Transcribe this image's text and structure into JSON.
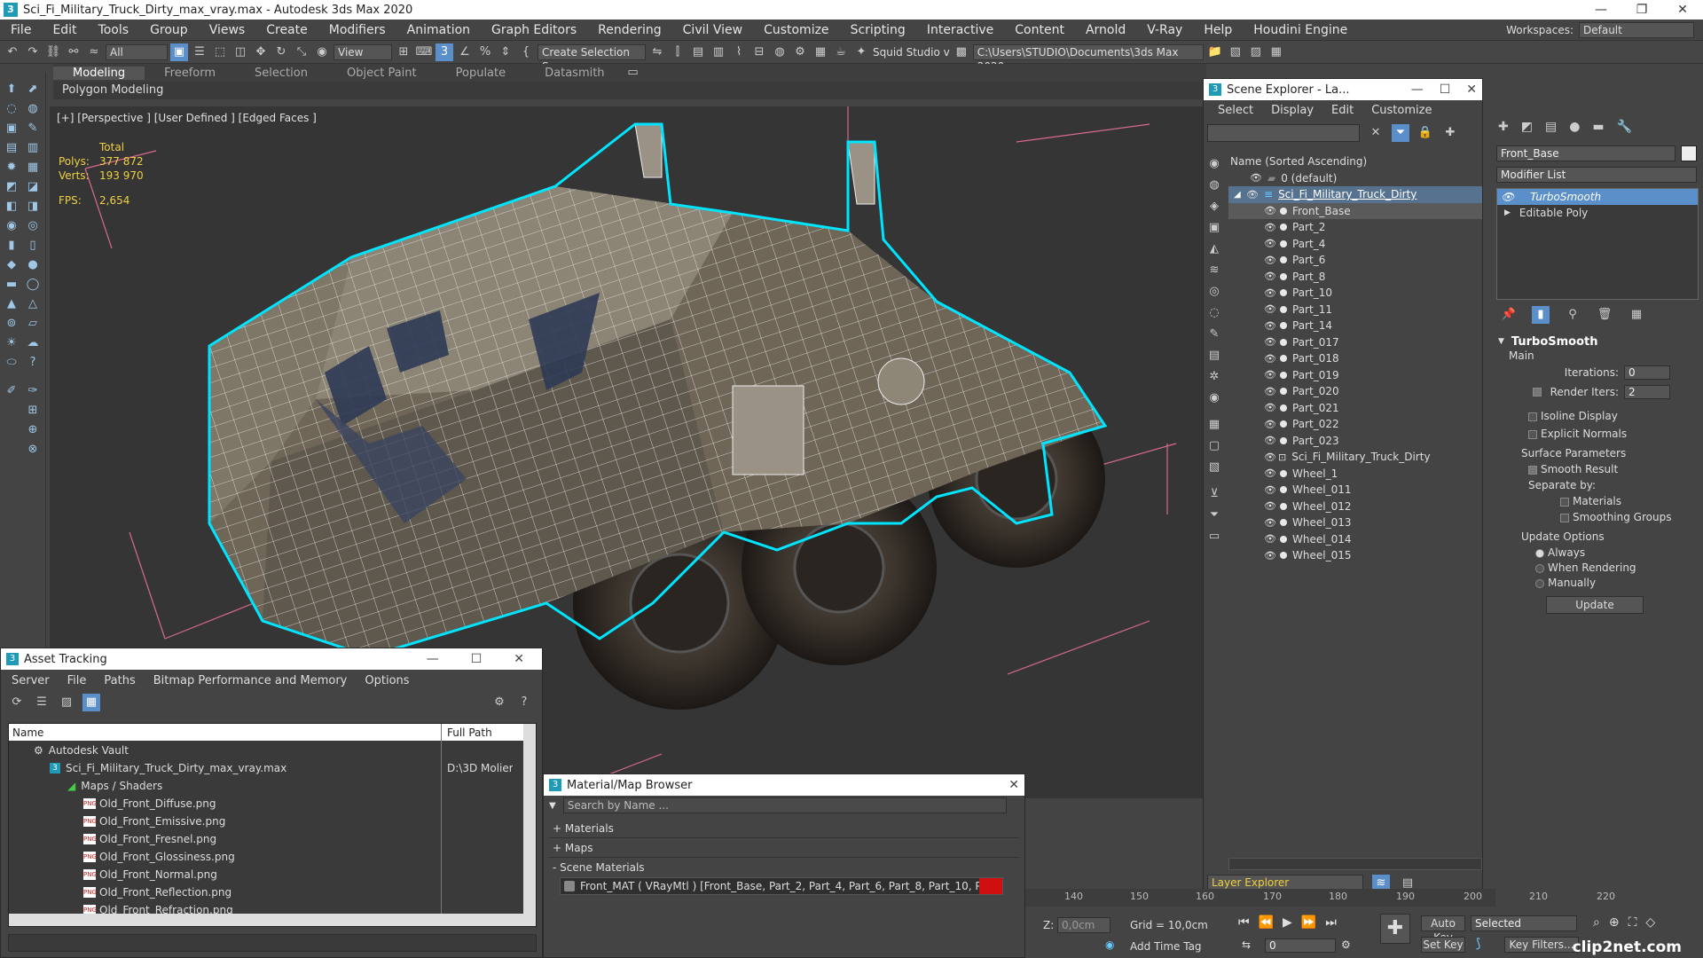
{
  "window": {
    "title": "Sci_Fi_Military_Truck_Dirty_max_vray.max - Autodesk 3ds Max 2020",
    "app_icon": "3"
  },
  "menu": {
    "items": [
      "File",
      "Edit",
      "Tools",
      "Group",
      "Views",
      "Create",
      "Modifiers",
      "Animation",
      "Graph Editors",
      "Rendering",
      "Civil View",
      "Customize",
      "Scripting",
      "Interactive",
      "Content",
      "Arnold",
      "V-Ray",
      "Help",
      "Houdini Engine"
    ],
    "workspaces_label": "Workspaces:",
    "workspace_value": "Default"
  },
  "toolbar": {
    "filter_value": "All",
    "view_value": "View",
    "selection_set_placeholder": "Create Selection Se",
    "user_label": "Squid Studio v",
    "project_path": "C:\\Users\\STUDIO\\Documents\\3ds Max 2020"
  },
  "ribbon": {
    "tabs": [
      "Modeling",
      "Freeform",
      "Selection",
      "Object Paint",
      "Populate",
      "Datasmith"
    ],
    "active": "Modeling",
    "subpanel": "Polygon Modeling"
  },
  "viewport": {
    "label": "[+] [Perspective ] [User Defined ] [Edged Faces ]",
    "stats": {
      "total_label": "Total",
      "polys_label": "Polys:",
      "polys_value": "377 872",
      "verts_label": "Verts:",
      "verts_value": "193 970",
      "fps_label": "FPS:",
      "fps_value": "2,654"
    }
  },
  "scene_explorer": {
    "title": "Scene Explorer - La...",
    "menu": [
      "Select",
      "Display",
      "Edit",
      "Customize"
    ],
    "column_header": "Name (Sorted Ascending)",
    "default_layer": "0 (default)",
    "root": "Sci_Fi_Military_Truck_Dirty",
    "children": [
      "Front_Base",
      "Part_2",
      "Part_4",
      "Part_6",
      "Part_8",
      "Part_10",
      "Part_11",
      "Part_14",
      "Part_017",
      "Part_018",
      "Part_019",
      "Part_020",
      "Part_021",
      "Part_022",
      "Part_023",
      "Sci_Fi_Military_Truck_Dirty",
      "Wheel_1",
      "Wheel_011",
      "Wheel_012",
      "Wheel_013",
      "Wheel_014",
      "Wheel_015"
    ],
    "footer": "Layer Explorer"
  },
  "command_panel": {
    "object_name": "Front_Base",
    "modifier_list_label": "Modifier List",
    "stack": [
      "TurboSmooth",
      "Editable Poly"
    ],
    "turbosmooth": {
      "title": "TurboSmooth",
      "main_label": "Main",
      "iterations_label": "Iterations:",
      "iterations_value": "0",
      "render_iters_label": "Render Iters:",
      "render_iters_value": "2",
      "isoline_label": "Isoline Display",
      "explicit_normals_label": "Explicit Normals",
      "surface_params_label": "Surface Parameters",
      "smooth_result_label": "Smooth Result",
      "separate_by_label": "Separate by:",
      "materials_label": "Materials",
      "smoothing_groups_label": "Smoothing Groups",
      "update_options_label": "Update Options",
      "always_label": "Always",
      "when_rendering_label": "When Rendering",
      "manually_label": "Manually",
      "update_button": "Update"
    }
  },
  "asset_tracking": {
    "title": "Asset Tracking",
    "menu": [
      "Server",
      "File",
      "Paths",
      "Bitmap Performance and Memory",
      "Options"
    ],
    "col_name": "Name",
    "col_path": "Full Path",
    "rows": [
      {
        "name": "Autodesk Vault",
        "path": "",
        "level": 1,
        "icon": "vault"
      },
      {
        "name": "Sci_Fi_Military_Truck_Dirty_max_vray.max",
        "path": "D:\\3D Molier",
        "level": 2,
        "icon": "max"
      },
      {
        "name": "Maps / Shaders",
        "path": "",
        "level": 3,
        "icon": "maps"
      },
      {
        "name": "Old_Front_Diffuse.png",
        "path": "",
        "level": 4,
        "icon": "png"
      },
      {
        "name": "Old_Front_Emissive.png",
        "path": "",
        "level": 4,
        "icon": "png"
      },
      {
        "name": "Old_Front_Fresnel.png",
        "path": "",
        "level": 4,
        "icon": "png"
      },
      {
        "name": "Old_Front_Glossiness.png",
        "path": "",
        "level": 4,
        "icon": "png"
      },
      {
        "name": "Old_Front_Normal.png",
        "path": "",
        "level": 4,
        "icon": "png"
      },
      {
        "name": "Old_Front_Reflection.png",
        "path": "",
        "level": 4,
        "icon": "png"
      },
      {
        "name": "Old_Front_Refraction.png",
        "path": "",
        "level": 4,
        "icon": "png"
      }
    ]
  },
  "material_browser": {
    "title": "Material/Map Browser",
    "search_placeholder": "Search by Name ...",
    "sections": [
      "+ Materials",
      "+ Maps",
      "- Scene Materials"
    ],
    "scene_material": "Front_MAT  ( VRayMtl )  [Front_Base, Part_2, Part_4, Part_6, Part_8, Part_10, Pa..."
  },
  "timeline": {
    "ticks": [
      "140",
      "150",
      "160",
      "170",
      "180",
      "190",
      "200",
      "210",
      "220"
    ]
  },
  "status": {
    "z_label": "Z:",
    "z_value": "0,0cm",
    "grid_label": "Grid = 10,0cm",
    "add_time_tag": "Add Time Tag",
    "auto_key": "Auto Key",
    "set_key": "Set Key",
    "selected_value": "Selected",
    "key_filters": "Key Filters...",
    "frame_value": "0"
  },
  "watermark": "clip2net.com",
  "colors": {
    "selection_cyan": "#00e5ff",
    "stats_yellow": "#f0d040",
    "active_blue": "#5a8fc9"
  }
}
